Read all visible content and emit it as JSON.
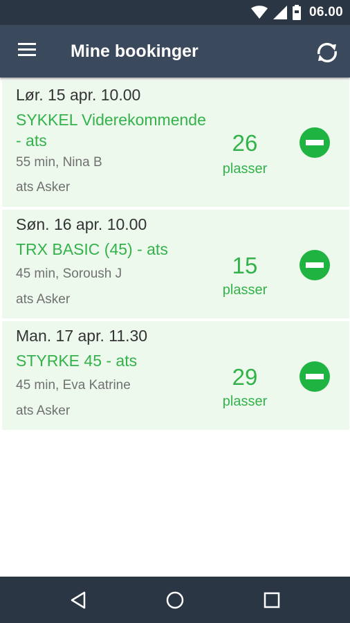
{
  "status_bar": {
    "time": "06.00",
    "icons": [
      "wifi-icon",
      "signal-icon",
      "battery-icon"
    ]
  },
  "app_bar": {
    "title": "Mine bookinger",
    "menu_icon": "menu-icon",
    "refresh_icon": "refresh-icon"
  },
  "bookings": [
    {
      "date": "Lør. 15 apr. 10.00",
      "title": "SYKKEL Viderekommende - ats",
      "details": "55 min, Nina B",
      "location": "ats Asker",
      "count": "26",
      "count_label": "plasser"
    },
    {
      "date": "Søn. 16 apr. 10.00",
      "title": "TRX BASIC (45) - ats",
      "details": "45 min, Soroush J",
      "location": "ats Asker",
      "count": "15",
      "count_label": "plasser"
    },
    {
      "date": "Man. 17 apr. 11.30",
      "title": "STYRKE 45 - ats",
      "details": "45 min, Eva Katrine",
      "location": "ats Asker",
      "count": "29",
      "count_label": "plasser"
    }
  ],
  "nav_bar": {
    "icons": [
      "back-icon",
      "home-icon",
      "recents-icon"
    ]
  },
  "colors": {
    "app_bar": "#3a4a5c",
    "status_bar": "#2b3644",
    "accent_green": "#33b24a",
    "card_bg": "#eef9ee"
  }
}
